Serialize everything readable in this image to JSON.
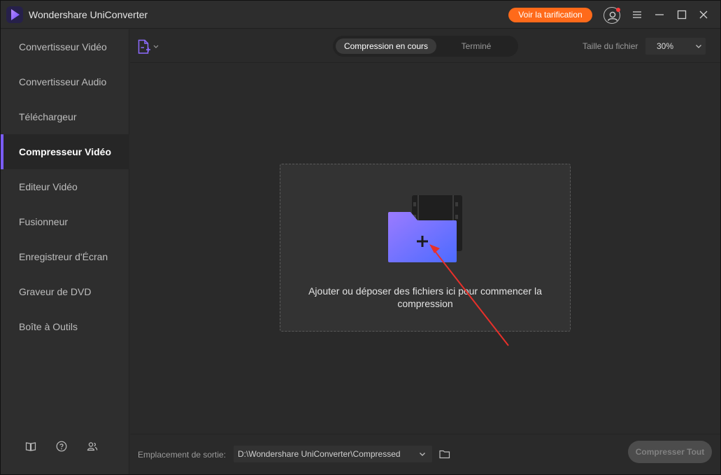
{
  "window": {
    "title": "Wondershare UniConverter",
    "pricing_label": "Voir la tarification"
  },
  "sidebar": {
    "items": [
      {
        "label": "Convertisseur Vidéo"
      },
      {
        "label": "Convertisseur Audio"
      },
      {
        "label": "Téléchargeur"
      },
      {
        "label": "Compresseur Vidéo"
      },
      {
        "label": "Editeur Vidéo"
      },
      {
        "label": "Fusionneur"
      },
      {
        "label": "Enregistreur d'Écran"
      },
      {
        "label": "Graveur de DVD"
      },
      {
        "label": "Boîte à Outils"
      }
    ],
    "active_index": 3,
    "footer_icons": [
      "book-icon",
      "help-icon",
      "users-icon"
    ]
  },
  "toolbar": {
    "tabs": [
      {
        "label": "Compression en cours"
      },
      {
        "label": "Terminé"
      }
    ],
    "file_size_label": "Taille du fichier",
    "file_size_value": "30%"
  },
  "dropzone": {
    "text": "Ajouter ou déposer des fichiers ici pour commencer la compression"
  },
  "footer": {
    "output_label": "Emplacement de sortie:",
    "output_path": "D:\\Wondershare UniConverter\\Compressed",
    "compress_all_label": "Compresser Tout"
  },
  "colors": {
    "accent": "#7b5cff",
    "pricing": "#ff6a1a",
    "annotation_arrow": "#e8302a"
  }
}
